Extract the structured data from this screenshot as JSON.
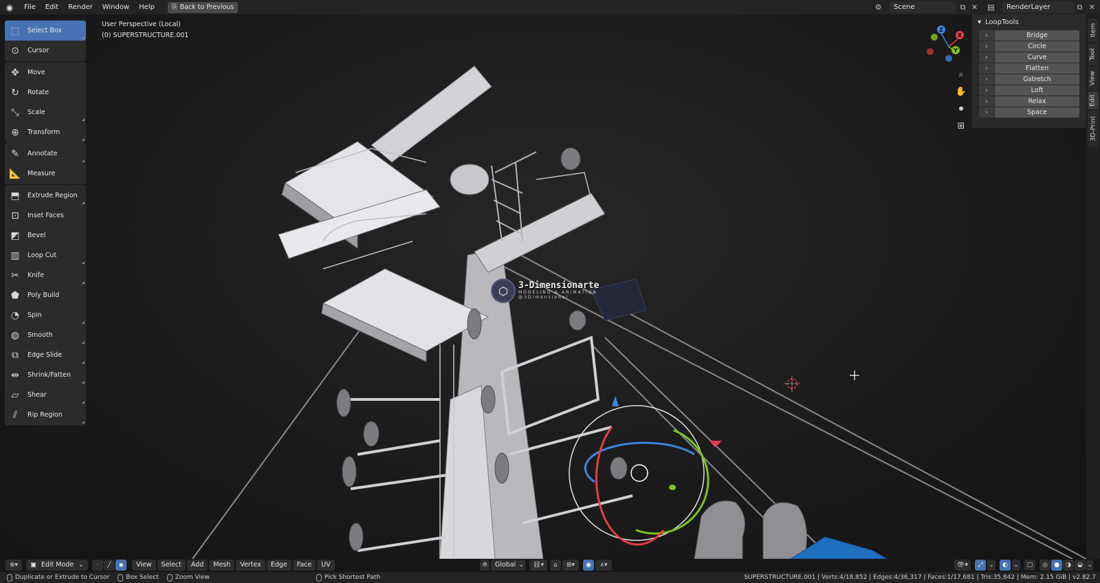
{
  "menubar": {
    "logo_icon": "blender-icon",
    "items": [
      "File",
      "Edit",
      "Render",
      "Window",
      "Help"
    ],
    "back_button": "Back to Previous",
    "scene": "Scene",
    "render_layer": "RenderLayer"
  },
  "viewport": {
    "perspective": "User Perspective (Local)",
    "object": "(0) SUPERSTRUCTURE.001",
    "watermark_title": "3-Dimensionarte",
    "watermark_sub1": "MODELING & ANIMATION",
    "watermark_sub2": "@3Dimensional"
  },
  "gizmo_axes": {
    "x": "X",
    "y": "Y",
    "z": "Z"
  },
  "toolbar": {
    "groups": [
      [
        "Select Box",
        "Cursor"
      ],
      [
        "Move",
        "Rotate",
        "Scale",
        "Transform"
      ],
      [
        "Annotate",
        "Measure"
      ],
      [
        "Extrude Region",
        "Inset Faces",
        "Bevel",
        "Loop Cut",
        "Knife",
        "Poly Build",
        "Spin",
        "Smooth",
        "Edge Slide",
        "Shrink/Fatten",
        "Shear",
        "Rip Region"
      ]
    ]
  },
  "sidebar": {
    "panel_title": "LoopTools",
    "buttons": [
      "Bridge",
      "Circle",
      "Curve",
      "Flatten",
      "Gstretch",
      "Loft",
      "Relax",
      "Space"
    ],
    "tabs": [
      "Item",
      "Tool",
      "View",
      "Edit",
      "3D-Print"
    ]
  },
  "footer": {
    "mode": "Edit Mode",
    "menus": [
      "View",
      "Select",
      "Add",
      "Mesh",
      "Vertex",
      "Edge",
      "Face",
      "UV"
    ],
    "orientation": "Global"
  },
  "statusbar": {
    "left_hint": "Duplicate or Extrude to Cursor",
    "mid_hint": "Box Select",
    "zoom_hint": "Zoom View",
    "path_hint": "Pick Shortest Path",
    "stats": "SUPERSTRUCTURE.001 | Verts:4/18,852 | Edges:4/36,317 | Faces:1/17,681 | Tris:35,842 | Mem: 2.15 GiB | v2.82.7"
  },
  "colors": {
    "accent": "#4772b3",
    "x_axis": "#e83a4a",
    "y_axis": "#7dc41f",
    "z_axis": "#3b86e0"
  }
}
